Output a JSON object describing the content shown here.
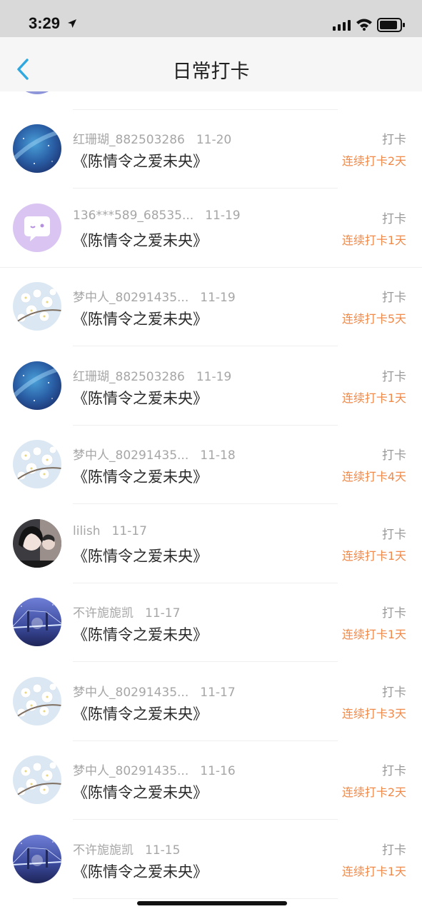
{
  "status": {
    "time": "3:29"
  },
  "nav": {
    "title": "日常打卡"
  },
  "items": [
    {
      "user": "红珊瑚_882503286",
      "date": "11-20",
      "book": "《陈情令之爱未央》",
      "type": "打卡",
      "streak": "连续打卡2天",
      "avatar": "galaxy"
    },
    {
      "user": "136***589_68535...",
      "date": "11-19",
      "book": "《陈情令之爱未央》",
      "type": "打卡",
      "streak": "连续打卡1天",
      "avatar": "chat-bubble"
    },
    {
      "user": "梦中人_80291435...",
      "date": "11-19",
      "book": "《陈情令之爱未央》",
      "type": "打卡",
      "streak": "连续打卡5天",
      "avatar": "blossom"
    },
    {
      "user": "红珊瑚_882503286",
      "date": "11-19",
      "book": "《陈情令之爱未央》",
      "type": "打卡",
      "streak": "连续打卡1天",
      "avatar": "galaxy"
    },
    {
      "user": "梦中人_80291435...",
      "date": "11-18",
      "book": "《陈情令之爱未央》",
      "type": "打卡",
      "streak": "连续打卡4天",
      "avatar": "blossom"
    },
    {
      "user": "lilish",
      "date": "11-17",
      "book": "《陈情令之爱未央》",
      "type": "打卡",
      "streak": "连续打卡1天",
      "avatar": "portrait"
    },
    {
      "user": "不许旎旎凯",
      "date": "11-17",
      "book": "《陈情令之爱未央》",
      "type": "打卡",
      "streak": "连续打卡1天",
      "avatar": "bridge"
    },
    {
      "user": "梦中人_80291435...",
      "date": "11-17",
      "book": "《陈情令之爱未央》",
      "type": "打卡",
      "streak": "连续打卡3天",
      "avatar": "blossom"
    },
    {
      "user": "梦中人_80291435...",
      "date": "11-16",
      "book": "《陈情令之爱未央》",
      "type": "打卡",
      "streak": "连续打卡2天",
      "avatar": "blossom"
    },
    {
      "user": "不许旎旎凯",
      "date": "11-15",
      "book": "《陈情令之爱未央》",
      "type": "打卡",
      "streak": "连续打卡1天",
      "avatar": "bridge"
    }
  ],
  "colors": {
    "accent": "#2fa8e0",
    "streak": "#f08a4b",
    "meta": "#a6a6a6"
  }
}
